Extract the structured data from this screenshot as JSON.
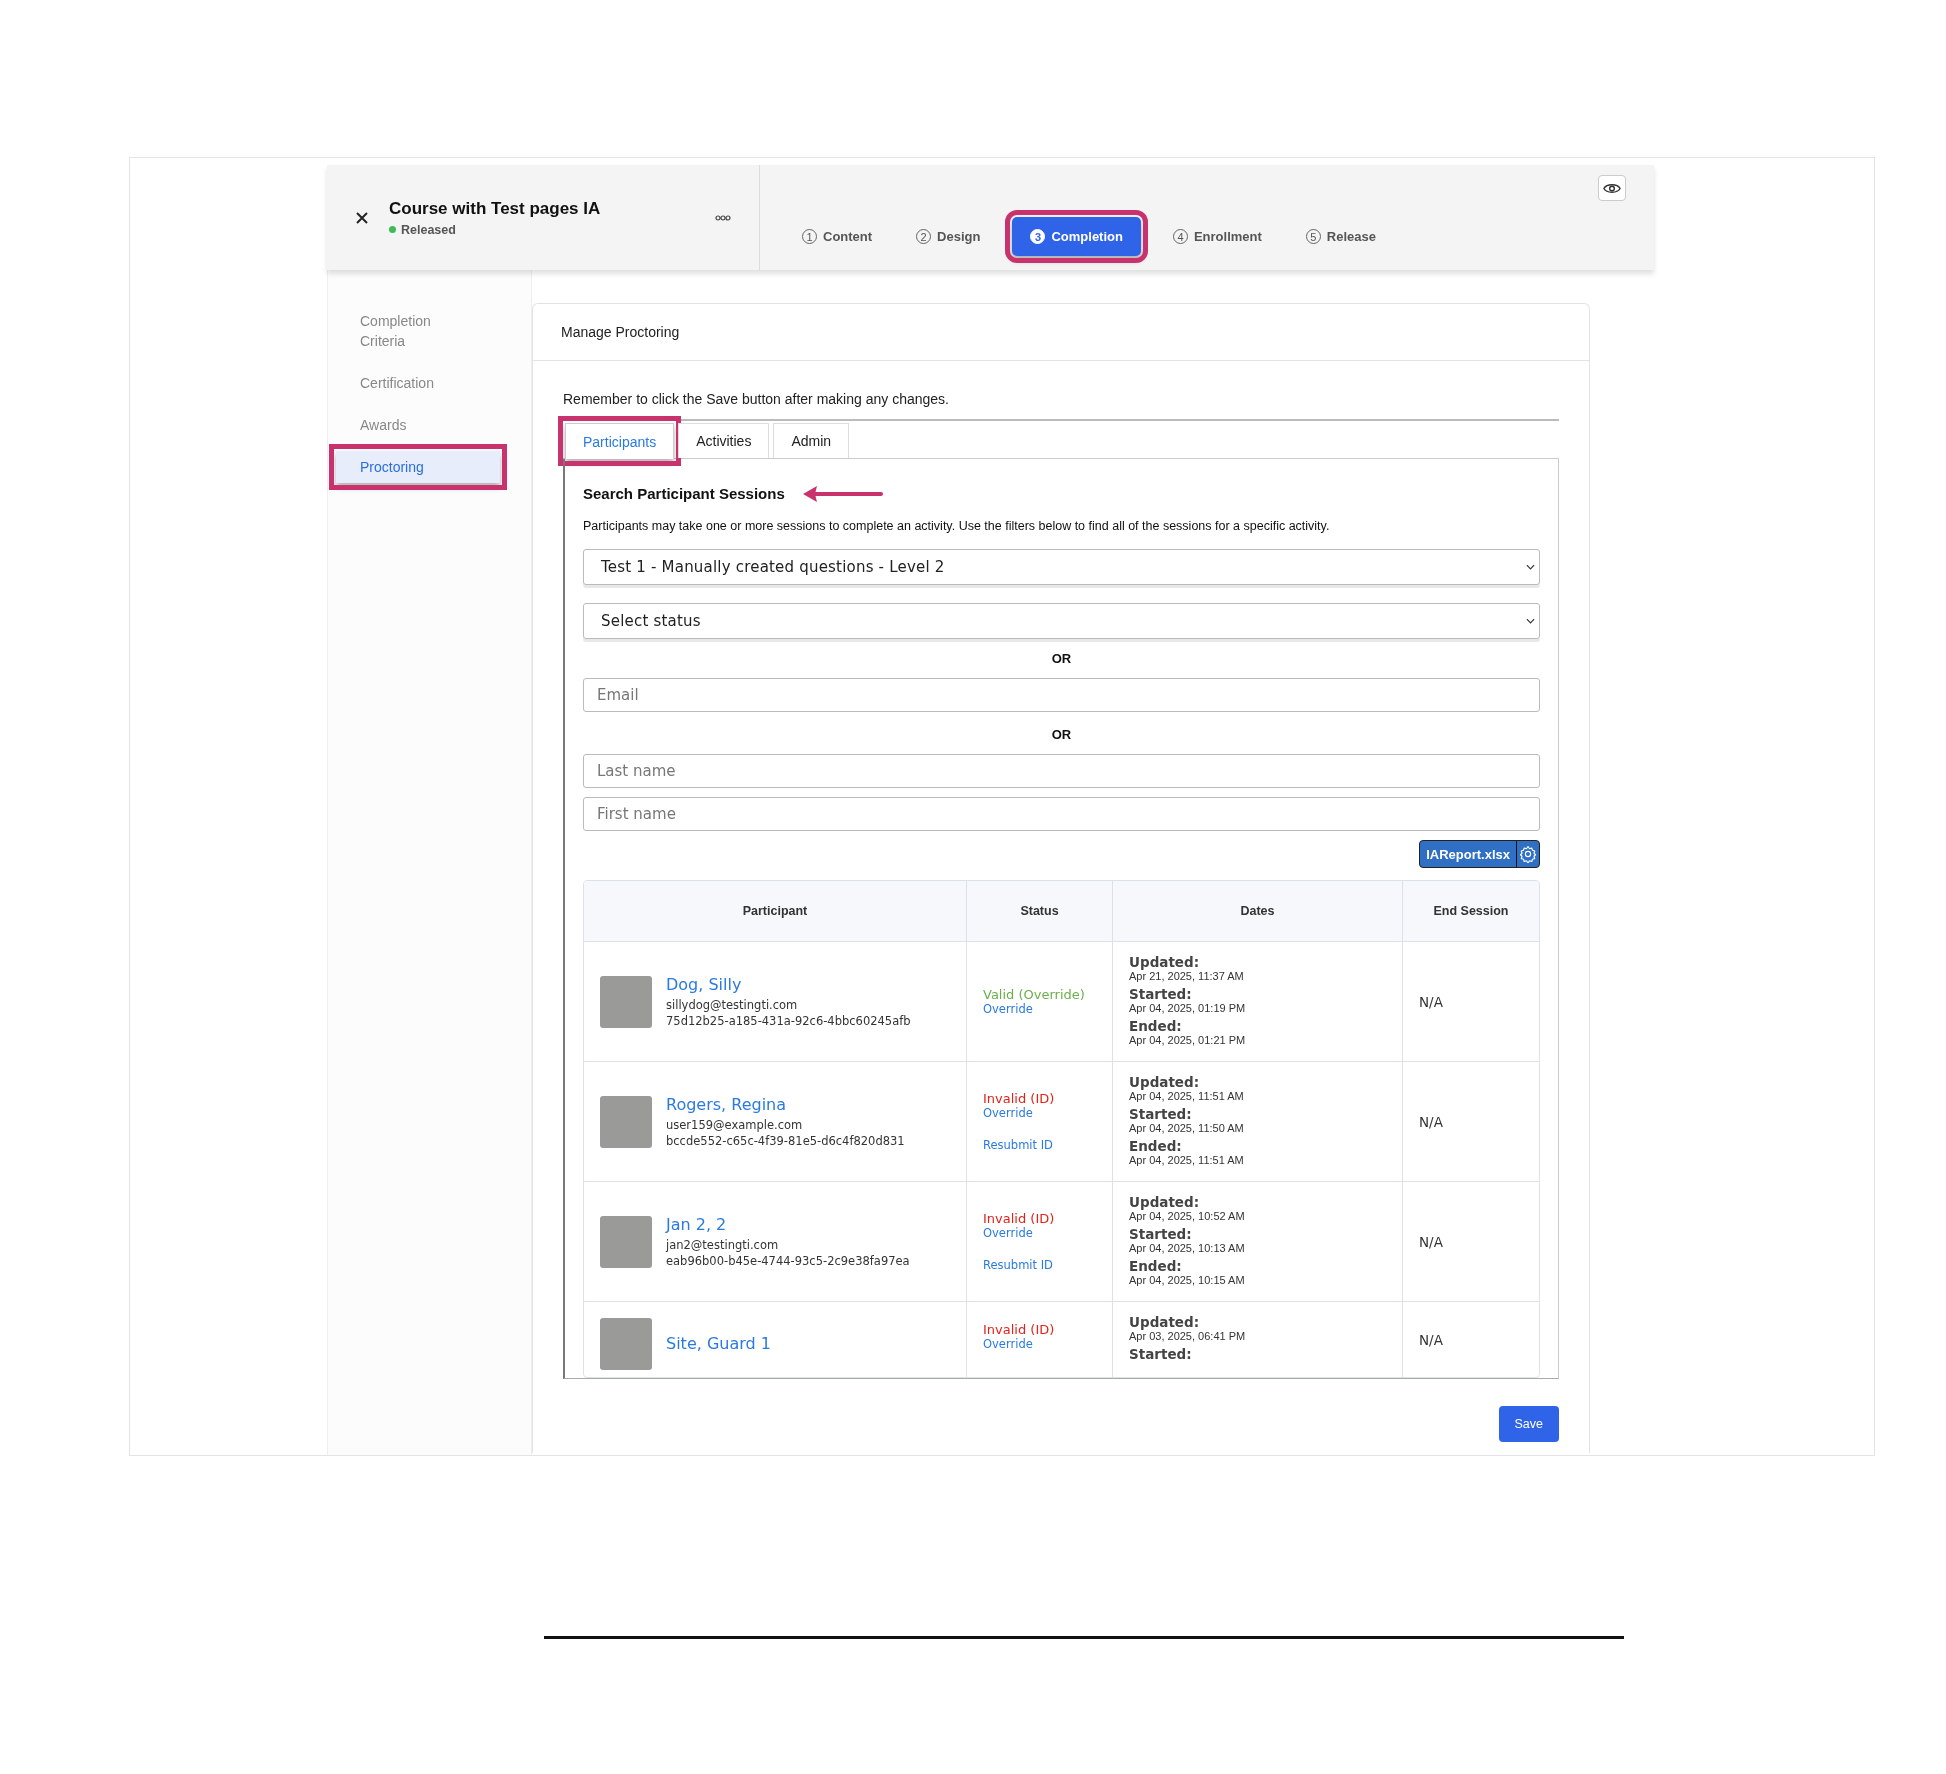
{
  "course": {
    "title": "Course with Test pages IA",
    "status": "Released"
  },
  "steps": [
    {
      "number": "1",
      "label": "Content",
      "selected": false,
      "highlighted": false
    },
    {
      "number": "2",
      "label": "Design",
      "selected": false,
      "highlighted": false
    },
    {
      "number": "3",
      "label": "Completion",
      "selected": true,
      "highlighted": true
    },
    {
      "number": "4",
      "label": "Enrollment",
      "selected": false,
      "highlighted": false
    },
    {
      "number": "5",
      "label": "Release",
      "selected": false,
      "highlighted": false
    }
  ],
  "sidebar": {
    "items": [
      {
        "label": "Completion Criteria",
        "selected": false,
        "highlighted": false
      },
      {
        "label": "Certification",
        "selected": false,
        "highlighted": false
      },
      {
        "label": "Awards",
        "selected": false,
        "highlighted": false
      },
      {
        "label": "Proctoring",
        "selected": true,
        "highlighted": true
      }
    ]
  },
  "panel": {
    "title": "Manage Proctoring",
    "note": "Remember to click the Save button after making any changes.",
    "tabs": [
      {
        "label": "Participants",
        "selected": true,
        "highlighted": true
      },
      {
        "label": "Activities",
        "selected": false,
        "highlighted": false
      },
      {
        "label": "Admin",
        "selected": false,
        "highlighted": false
      }
    ],
    "heading": "Search Participant Sessions",
    "heading_arrow": true,
    "description": "Participants may take one or more sessions to complete an activity. Use the filters below to find all of the sessions for a specific activity.",
    "filters": [
      {
        "kind": "select",
        "value": "Test 1 - Manually created questions - Level 2"
      },
      {
        "kind": "select",
        "placeholder": "Select status"
      },
      {
        "kind": "separator",
        "text": "OR"
      },
      {
        "kind": "input",
        "placeholder": "Email"
      },
      {
        "kind": "separator",
        "text": "OR"
      },
      {
        "kind": "input",
        "placeholder": "Last name"
      },
      {
        "kind": "input",
        "placeholder": "First name"
      }
    ],
    "report_button": "IAReport.xlsx",
    "table": {
      "columns": [
        "Participant",
        "Status",
        "Dates",
        "End Session"
      ],
      "rows": [
        {
          "name": "Dog, Silly",
          "email": "sillydog@testingti.com",
          "id": "75d12b25-a185-431a-92c6-4bbc60245afb",
          "status": "Valid (Override)",
          "valid": true,
          "actions": [
            "Override"
          ],
          "dates": [
            {
              "label": "Updated:",
              "value": "Apr 21, 2025, 11:37 AM"
            },
            {
              "label": "Started:",
              "value": "Apr 04, 2025, 01:19 PM"
            },
            {
              "label": "Ended:",
              "value": "Apr 04, 2025, 01:21 PM"
            }
          ],
          "end_session": "N/A"
        },
        {
          "name": "Rogers, Regina",
          "email": "user159@example.com",
          "id": "bccde552-c65c-4f39-81e5-d6c4f820d831",
          "status": "Invalid (ID)",
          "valid": false,
          "actions": [
            "Override",
            "Resubmit ID"
          ],
          "dates": [
            {
              "label": "Updated:",
              "value": "Apr 04, 2025, 11:51 AM"
            },
            {
              "label": "Started:",
              "value": "Apr 04, 2025, 11:50 AM"
            },
            {
              "label": "Ended:",
              "value": "Apr 04, 2025, 11:51 AM"
            }
          ],
          "end_session": "N/A"
        },
        {
          "name": "Jan 2, 2",
          "email": "jan2@testingti.com",
          "id": "eab96b00-b45e-4744-93c5-2c9e38fa97ea",
          "status": "Invalid (ID)",
          "valid": false,
          "actions": [
            "Override",
            "Resubmit ID"
          ],
          "dates": [
            {
              "label": "Updated:",
              "value": "Apr 04, 2025, 10:52 AM"
            },
            {
              "label": "Started:",
              "value": "Apr 04, 2025, 10:13 AM"
            },
            {
              "label": "Ended:",
              "value": "Apr 04, 2025, 10:15 AM"
            }
          ],
          "end_session": "N/A"
        },
        {
          "name": "Site, Guard 1",
          "status": "Invalid (ID)",
          "valid": false,
          "actions": [
            "Override"
          ],
          "dates": [
            {
              "label": "Updated:",
              "value": "Apr 03, 2025, 06:41 PM"
            },
            {
              "label": "Started:"
            }
          ],
          "end_session": "N/A"
        }
      ]
    }
  },
  "save_button": "Save"
}
